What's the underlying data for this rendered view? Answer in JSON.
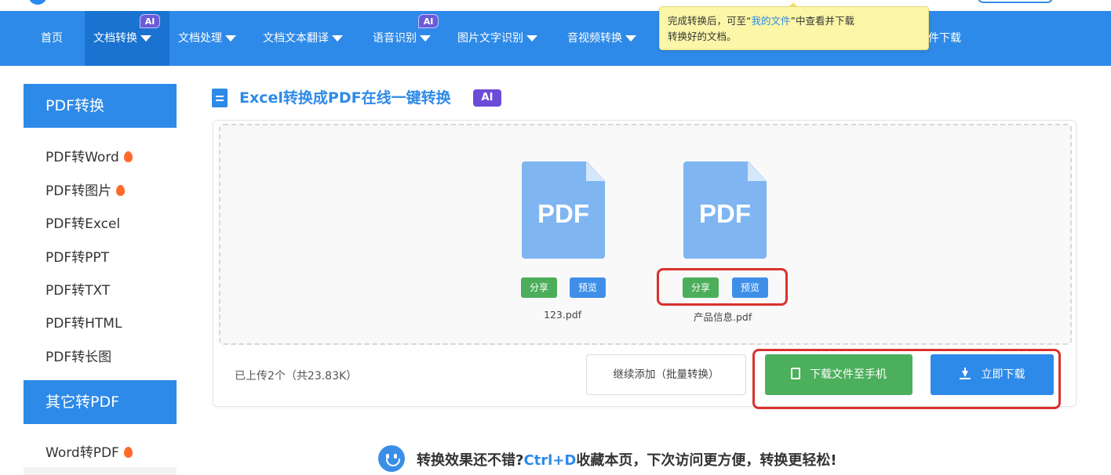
{
  "nav": {
    "items": [
      {
        "label": "首页",
        "dropdown": false,
        "active": false,
        "ai": false
      },
      {
        "label": "文档转换",
        "dropdown": true,
        "active": true,
        "ai": true
      },
      {
        "label": "文档处理",
        "dropdown": true,
        "active": false,
        "ai": false
      },
      {
        "label": "文档文本翻译",
        "dropdown": true,
        "active": false,
        "ai": false
      },
      {
        "label": "语音识别",
        "dropdown": true,
        "active": false,
        "ai": true
      },
      {
        "label": "图片文字识别",
        "dropdown": true,
        "active": false,
        "ai": false
      },
      {
        "label": "音视频转换",
        "dropdown": true,
        "active": false,
        "ai": false
      }
    ],
    "partial_right": "件下载",
    "ai_badge": "AI"
  },
  "tooltip": {
    "text_before": "完成转换后，可至“",
    "link": "我的文件",
    "text_after": "”中查看并下载",
    "line2": "转换好的文档。"
  },
  "sidebar": {
    "groups": [
      {
        "title": "PDF转换",
        "items": [
          {
            "label": "PDF转Word",
            "hot": true
          },
          {
            "label": "PDF转图片",
            "hot": true
          },
          {
            "label": "PDF转Excel",
            "hot": false
          },
          {
            "label": "PDF转PPT",
            "hot": false
          },
          {
            "label": "PDF转TXT",
            "hot": false
          },
          {
            "label": "PDF转HTML",
            "hot": false
          },
          {
            "label": "PDF转长图",
            "hot": false
          }
        ]
      },
      {
        "title": "其它转PDF",
        "items": [
          {
            "label": "Word转PDF",
            "hot": true
          }
        ]
      }
    ]
  },
  "main": {
    "title": "Excel转换成PDF在线一键转换",
    "ai_badge": "AI",
    "files": [
      {
        "icon_text": "PDF",
        "name": "123.pdf",
        "share_label": "分享",
        "preview_label": "预览"
      },
      {
        "icon_text": "PDF",
        "name": "产品信息.pdf",
        "share_label": "分享",
        "preview_label": "预览"
      }
    ],
    "status": "已上传2个（共23.83K）",
    "continue_label": "继续添加（批量转换）",
    "phone_label": "下载文件至手机",
    "download_label": "立即下载"
  },
  "promo": {
    "before": "转换效果还不错?",
    "shortcut": "Ctrl+D",
    "after": "收藏本页，下次访问更方便，转换更轻松!"
  },
  "colors": {
    "primary": "#2e8ae8",
    "green": "#4caf5c",
    "highlight": "#d9322e",
    "tooltip": "#fbf6a8"
  }
}
